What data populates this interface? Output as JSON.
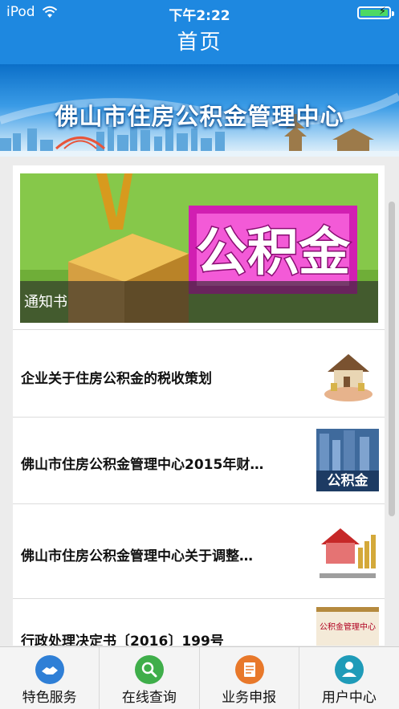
{
  "status_bar": {
    "carrier": "iPod",
    "time": "下午2:22"
  },
  "navbar": {
    "title": "首页"
  },
  "banner": {
    "title": "佛山市住房公积金管理中心"
  },
  "hero": {
    "image_text": "公积金",
    "caption": "通知书"
  },
  "news": [
    {
      "title": "企业关于住房公积金的税收策划",
      "thumb": "house-coins-hands"
    },
    {
      "title": "佛山市住房公积金管理中心2015年财…",
      "thumb": "city-gongjijin"
    },
    {
      "title": "佛山市住房公积金管理中心关于调整…",
      "thumb": "house-chart"
    },
    {
      "title": "行政处理决定书〔2016〕199号",
      "thumb": "gongjijin-sign",
      "thumb_text": "公积金管理中心"
    }
  ],
  "tabs": [
    {
      "label": "特色服务",
      "icon": "handshake-icon",
      "color": "#2f7fd6"
    },
    {
      "label": "在线查询",
      "icon": "search-icon",
      "color": "#3fae4a"
    },
    {
      "label": "业务申报",
      "icon": "document-icon",
      "color": "#e8782a"
    },
    {
      "label": "用户中心",
      "icon": "user-icon",
      "color": "#1f9bb8"
    }
  ]
}
